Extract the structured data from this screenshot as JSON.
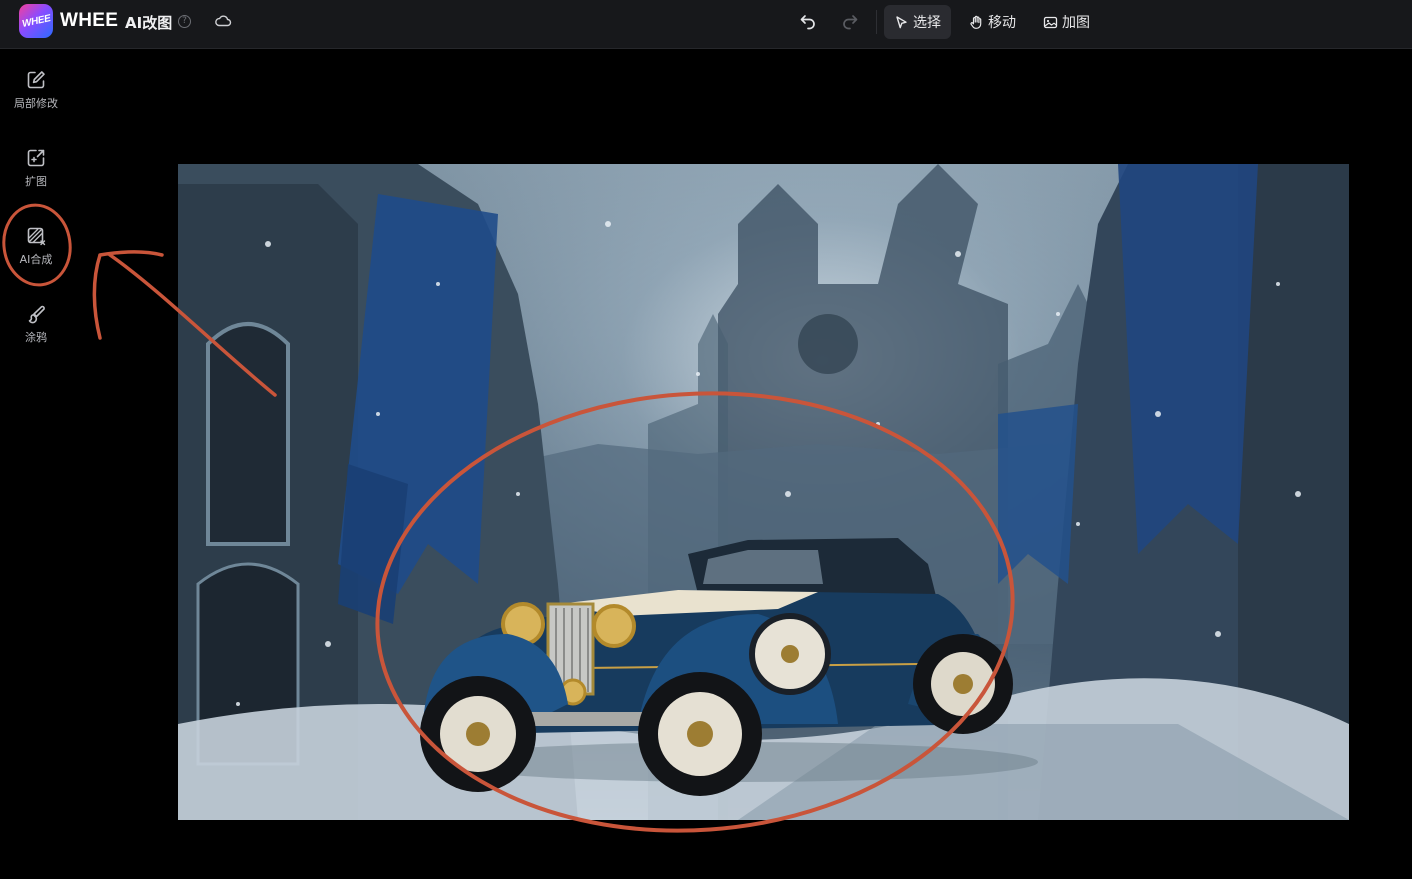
{
  "topbar": {
    "logo_text": "WHEE",
    "brand": "WHEE",
    "app_title": "AI改图",
    "help_icon": "question-circle-icon",
    "cloud_icon": "cloud-icon",
    "undo_icon": "undo-icon",
    "redo_icon": "redo-icon",
    "tools": {
      "select": {
        "label": "选择",
        "icon": "cursor-icon"
      },
      "move": {
        "label": "移动",
        "icon": "hand-icon"
      },
      "expand": {
        "label": "加图",
        "icon": "image-plus-icon"
      }
    }
  },
  "sidebar": {
    "items": [
      {
        "label": "局部修改",
        "icon": "edit-icon"
      },
      {
        "label": "扩图",
        "icon": "expand-image-icon"
      },
      {
        "label": "AI合成",
        "icon": "ai-compose-icon"
      },
      {
        "label": "涂鸦",
        "icon": "brush-icon"
      }
    ]
  },
  "canvas": {
    "image": "snowy-castle-street-with-vintage-blue-car"
  },
  "colors": {
    "topbar_bg": "#17181b",
    "canvas_bg": "#000000",
    "annotation": "#c9553a",
    "active_tool_bg": "#2a2b30"
  }
}
